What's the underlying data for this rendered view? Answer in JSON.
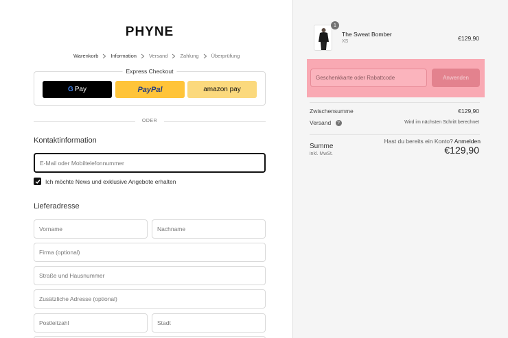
{
  "brand": "PHYNE",
  "breadcrumb": [
    "Warenkorb",
    "Information",
    "Versand",
    "Zahlung",
    "Überprüfung"
  ],
  "express": {
    "title": "Express Checkout",
    "gpay": "Pay",
    "paypal": "PayPal",
    "amazon": "amazon pay"
  },
  "divider": "ODER",
  "contact": {
    "title": "Kontaktinformation",
    "account_prompt": "Hast du bereits ein Konto?",
    "login": "Anmelden",
    "email_placeholder": "E-Mail oder Mobiltelefonnummer",
    "newsletter": "Ich möchte News und exklusive Angebote erhalten",
    "newsletter_checked": true
  },
  "shipping": {
    "title": "Lieferadresse",
    "first_name": "Vorname",
    "last_name": "Nachname",
    "company": "Firma (optional)",
    "street": "Straße und Hausnummer",
    "address2": "Zusätzliche Adresse (optional)",
    "zip": "Postleitzahl",
    "city": "Stadt"
  },
  "cart": {
    "product": {
      "name": "The Sweat Bomber",
      "variant": "XS",
      "price": "€129,90",
      "quantity": "1"
    },
    "discount_placeholder": "Geschenkkarte oder Rabattcode",
    "apply": "Anwenden",
    "subtotal_label": "Zwischensumme",
    "subtotal_value": "€129,90",
    "shipping_label": "Versand",
    "shipping_value": "Wird im nächsten Schritt berechnet",
    "total_label": "Summe",
    "total_sub": "inkl. MwSt.",
    "total_value": "€129,90"
  }
}
